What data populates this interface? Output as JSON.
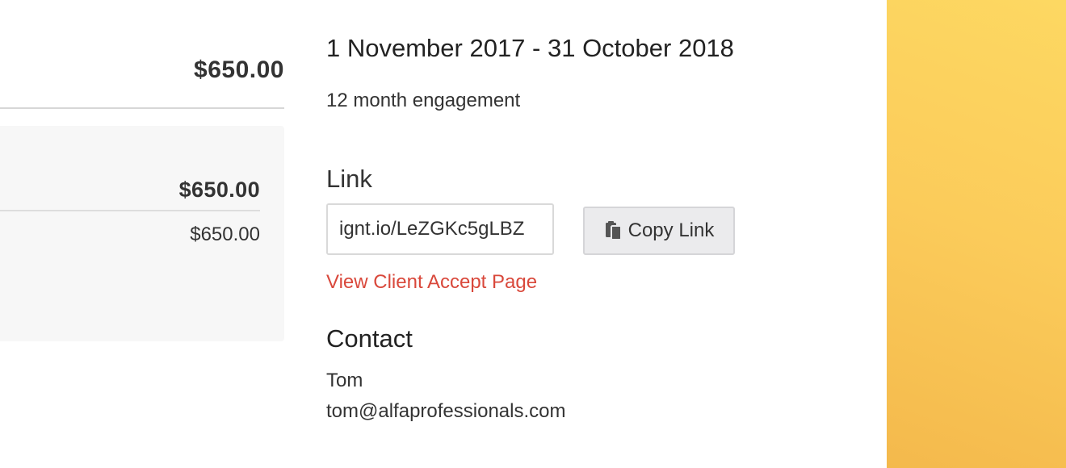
{
  "summary": {
    "top_total": "$650.00",
    "panel_total": "$650.00",
    "panel_subtotal": "$650.00"
  },
  "details": {
    "date_range": "1 November 2017 - 31 October 2018",
    "engagement": "12 month engagement",
    "link_heading": "Link",
    "link_value": "ignt.io/LeZGKc5gLBZ",
    "copy_button_label": "Copy Link",
    "copy_icon": "clipboard-icon",
    "accept_page_link": "View Client Accept Page",
    "contact_heading": "Contact",
    "contact_name": "Tom",
    "contact_email": "tom@alfaprofessionals.com"
  },
  "colors": {
    "accent_link": "#d9483b",
    "side_panel": "#fbcb5a"
  }
}
